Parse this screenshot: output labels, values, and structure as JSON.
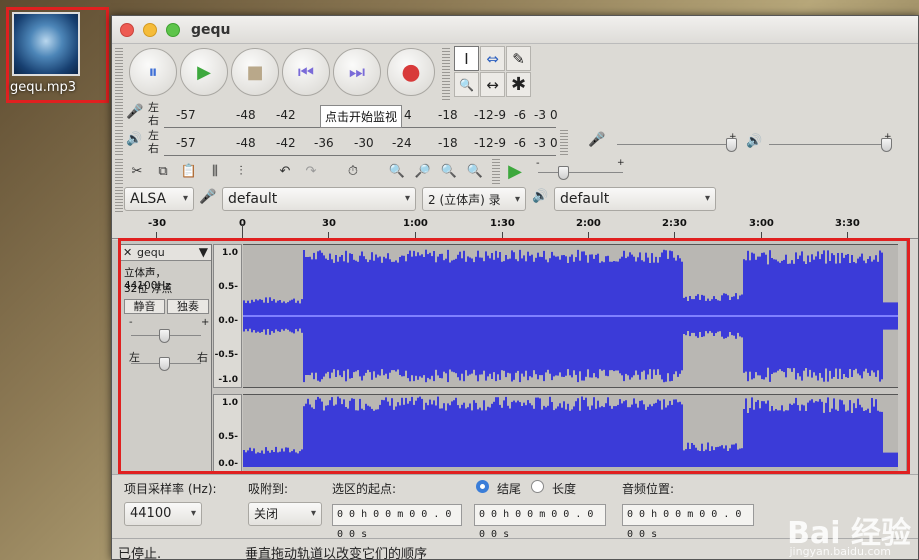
{
  "desktop": {
    "icon_label": "gequ.mp3"
  },
  "window": {
    "title": "gequ"
  },
  "transport": {
    "pause": "⏸",
    "play": "▶",
    "stop": "■",
    "skip_start": "⏮",
    "skip_end": "⏭",
    "record": "●"
  },
  "tools": {
    "select": "I",
    "envelope": "⇔",
    "draw": "✎",
    "zoom": "🔍",
    "timeshift": "↔",
    "multi": "✱"
  },
  "meters": {
    "record_lr": [
      "左",
      "右"
    ],
    "playback_lr": [
      "左",
      "右"
    ],
    "record_ticks": [
      "-57",
      "-48",
      "-42",
      "4",
      "-18",
      "-12",
      "-9",
      "-6",
      "-3",
      "0"
    ],
    "playback_ticks": [
      "-57",
      "-48",
      "-42",
      "-36",
      "-30",
      "-24",
      "-18",
      "-12",
      "-9",
      "-6",
      "-3",
      "0"
    ],
    "tooltip": "点击开始监视"
  },
  "mixer": {
    "plus1": "+",
    "plus2": "+",
    "minus": "-",
    "plus3": "+"
  },
  "devices": {
    "host": "ALSA",
    "recording_device": "default",
    "channels": "2 (立体声) 录",
    "playback_device": "default"
  },
  "ruler": {
    "labels": [
      "-30",
      "0",
      "30",
      "1:00",
      "1:30",
      "2:00",
      "2:30",
      "3:00",
      "3:30"
    ]
  },
  "track": {
    "name": "gequ",
    "format1": "立体声，44100Hz",
    "format2": "32位 浮点",
    "mute": "静音",
    "solo": "独奏",
    "gain_minus": "-",
    "gain_plus": "+",
    "pan_left": "左",
    "pan_right": "右",
    "scale_top": [
      "1.0",
      "0.5-",
      "0.0-",
      "-0.5-",
      "-1.0"
    ],
    "scale_bottom": [
      "1.0",
      "0.5-",
      "0.0-"
    ]
  },
  "selection": {
    "rate_label": "项目采样率 (Hz):",
    "rate_value": "44100",
    "snap_label": "吸附到:",
    "snap_value": "关闭",
    "start_label": "选区的起点:",
    "end_label": "结尾",
    "length_label": "长度",
    "audio_pos_label": "音频位置:",
    "time_start": "0 0 h 0 0 m 0 0 . 0 0 0 s",
    "time_end": "0 0 h 0 0 m 0 0 . 0 0 0 s",
    "time_pos": "0 0 h 0 0 m 0 0 . 0 0 0 s"
  },
  "status": {
    "left": "已停止.",
    "right": "垂直拖动轨道以改变它们的顺序"
  },
  "watermark": {
    "main": "Bai 经验",
    "sub": "jingyan.baidu.com"
  }
}
